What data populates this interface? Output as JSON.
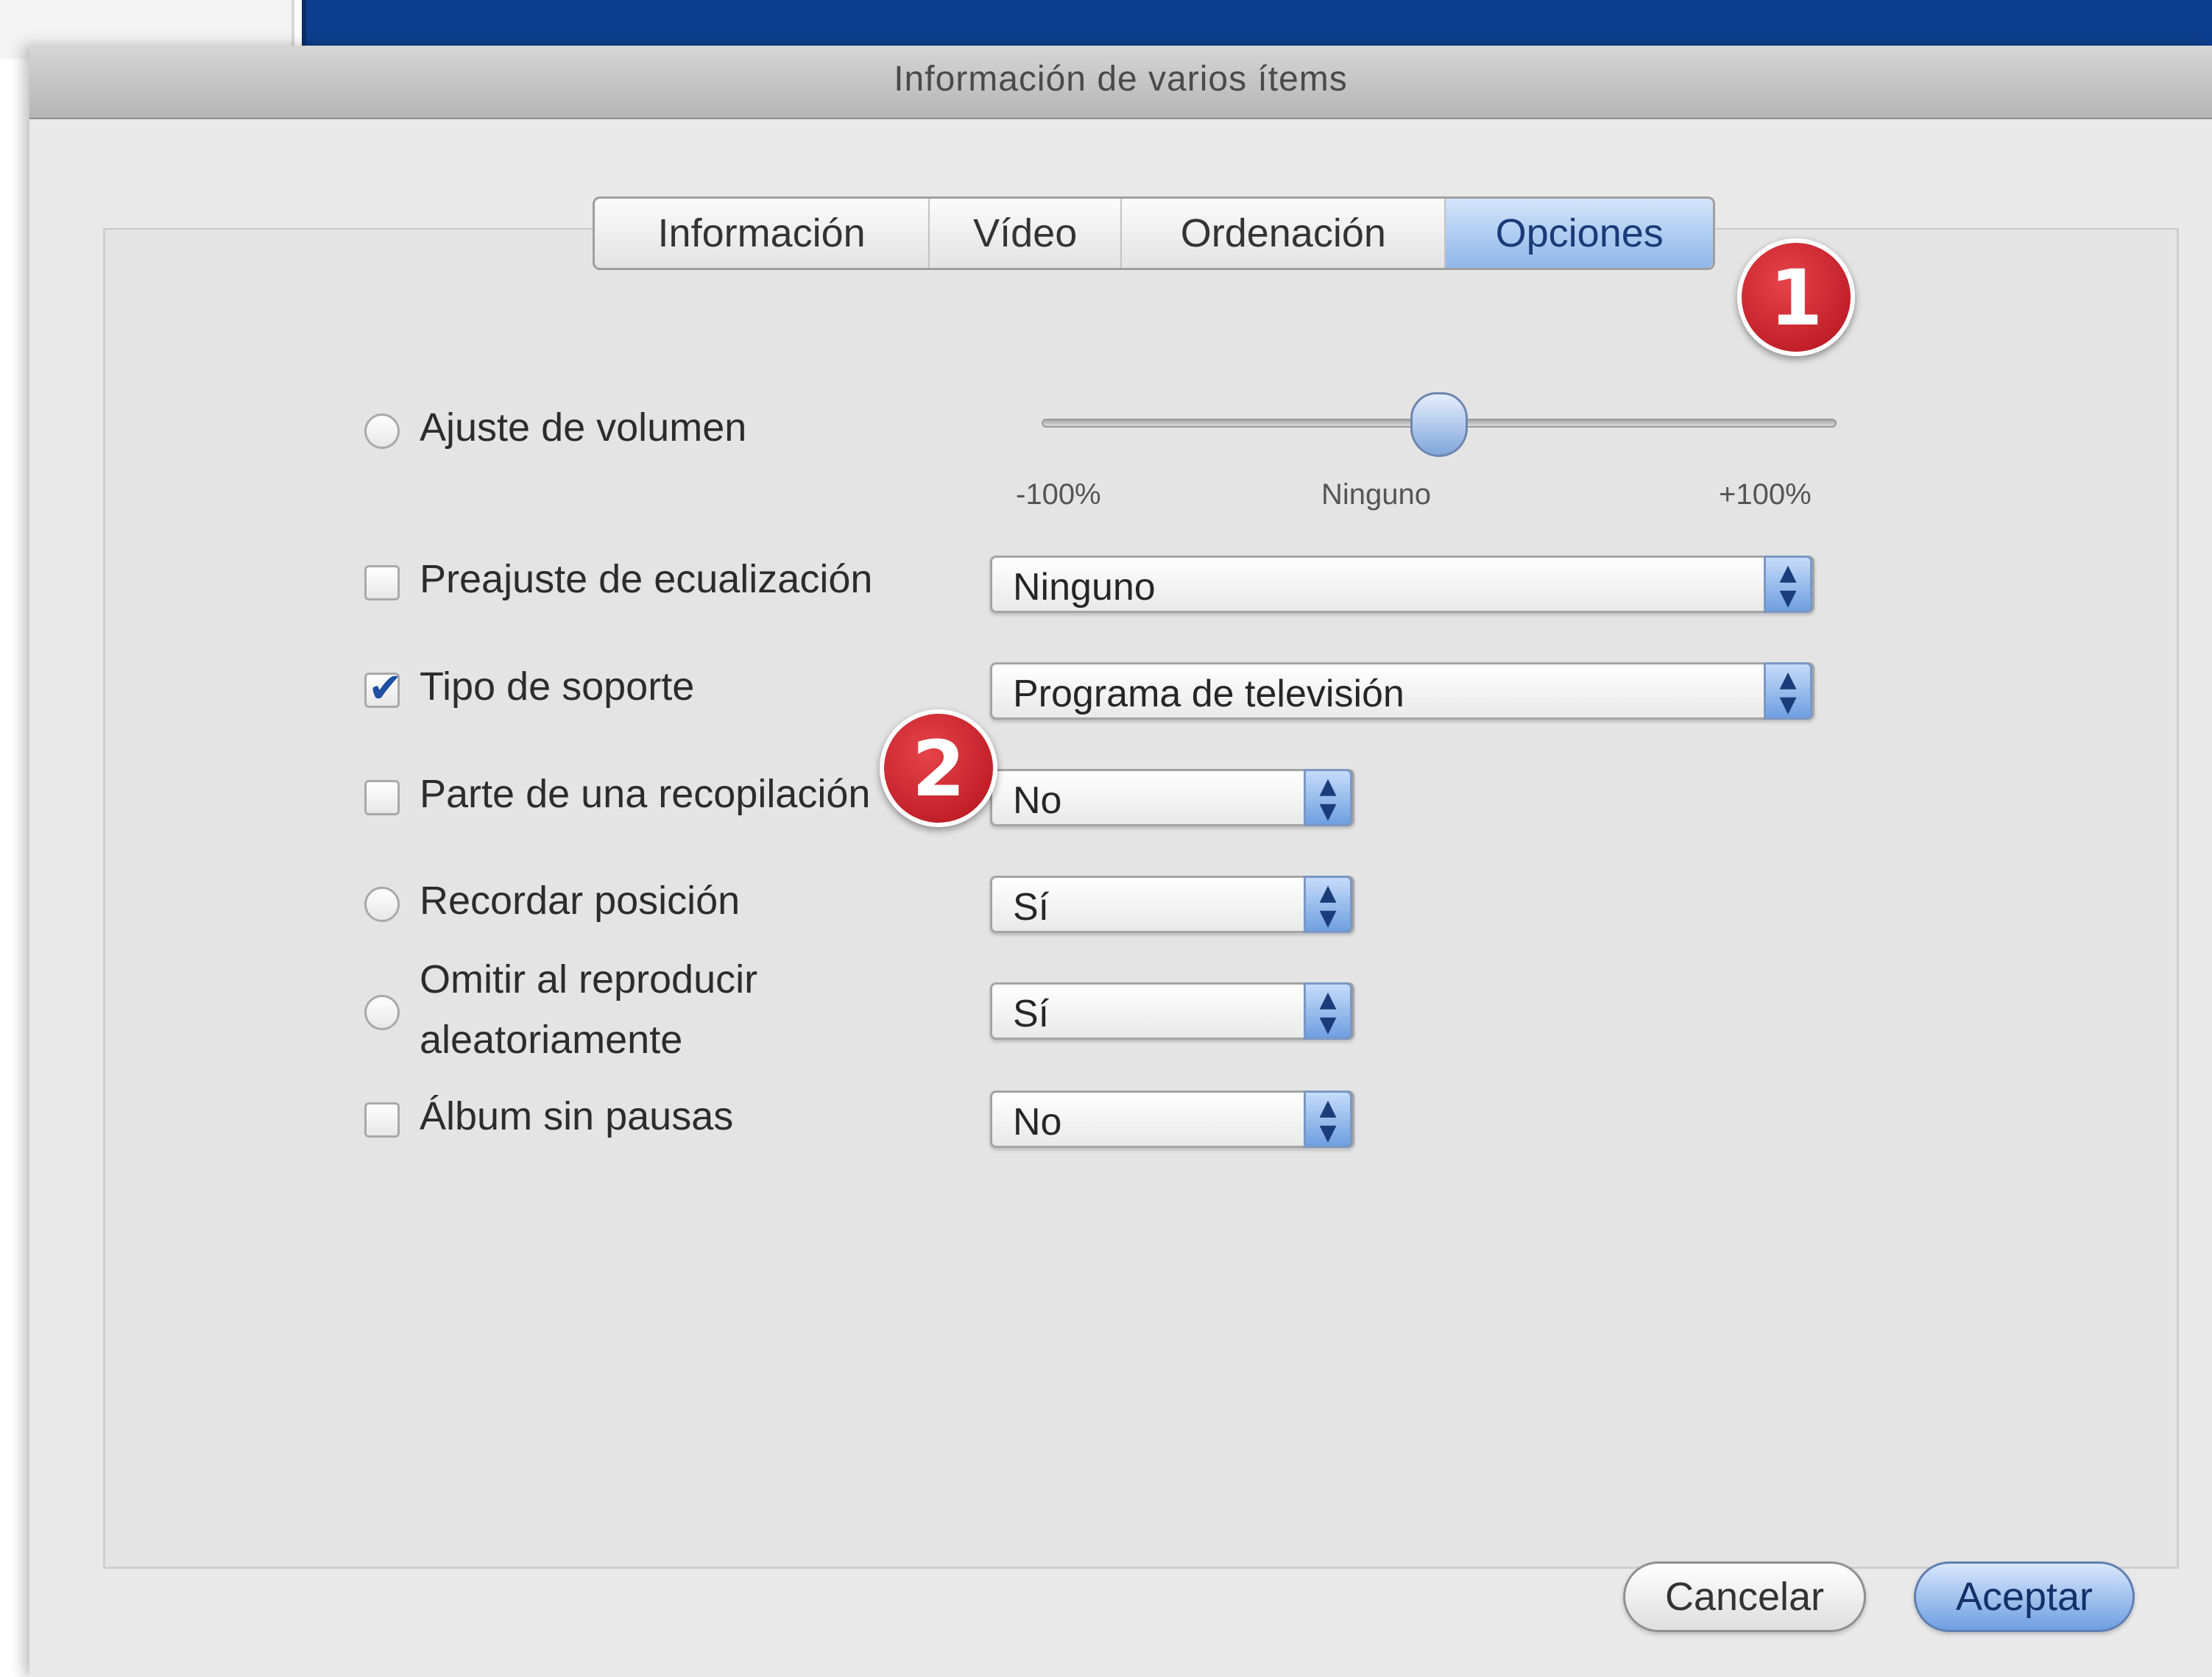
{
  "dialog": {
    "title": "Información de varios ítems"
  },
  "tabs": [
    {
      "label": "Información",
      "selected": false
    },
    {
      "label": "Vídeo",
      "selected": false
    },
    {
      "label": "Ordenación",
      "selected": false
    },
    {
      "label": "Opciones",
      "selected": true
    }
  ],
  "badges": [
    "1",
    "2"
  ],
  "options": {
    "volume": {
      "label": "Ajuste de volumen",
      "checked": false,
      "slider_value_fraction": 0.5,
      "tick_min": "-100%",
      "tick_mid": "Ninguno",
      "tick_max": "+100%"
    },
    "eq_preset": {
      "label": "Preajuste de ecualización",
      "checked": false,
      "value": "Ninguno"
    },
    "media_type": {
      "label": "Tipo de soporte",
      "checked": true,
      "value": "Programa de televisión"
    },
    "compilation": {
      "label": "Parte de una recopilación",
      "checked": false,
      "value": "No"
    },
    "remember_position": {
      "label": "Recordar posición",
      "checked": false,
      "value": "Sí"
    },
    "skip_shuffle": {
      "label_line1": "Omitir al reproducir",
      "label_line2": "aleatoriamente",
      "checked": false,
      "value": "Sí"
    },
    "gapless": {
      "label": "Álbum sin pausas",
      "checked": false,
      "value": "No"
    }
  },
  "buttons": {
    "cancel": "Cancelar",
    "ok": "Aceptar"
  },
  "colors": {
    "accent": "#6e9fe2",
    "badge": "#c8161f",
    "check": "#1f4fa4"
  },
  "icons": {
    "popup_arrows": "updown-arrows-icon",
    "check": "checkmark-icon"
  }
}
